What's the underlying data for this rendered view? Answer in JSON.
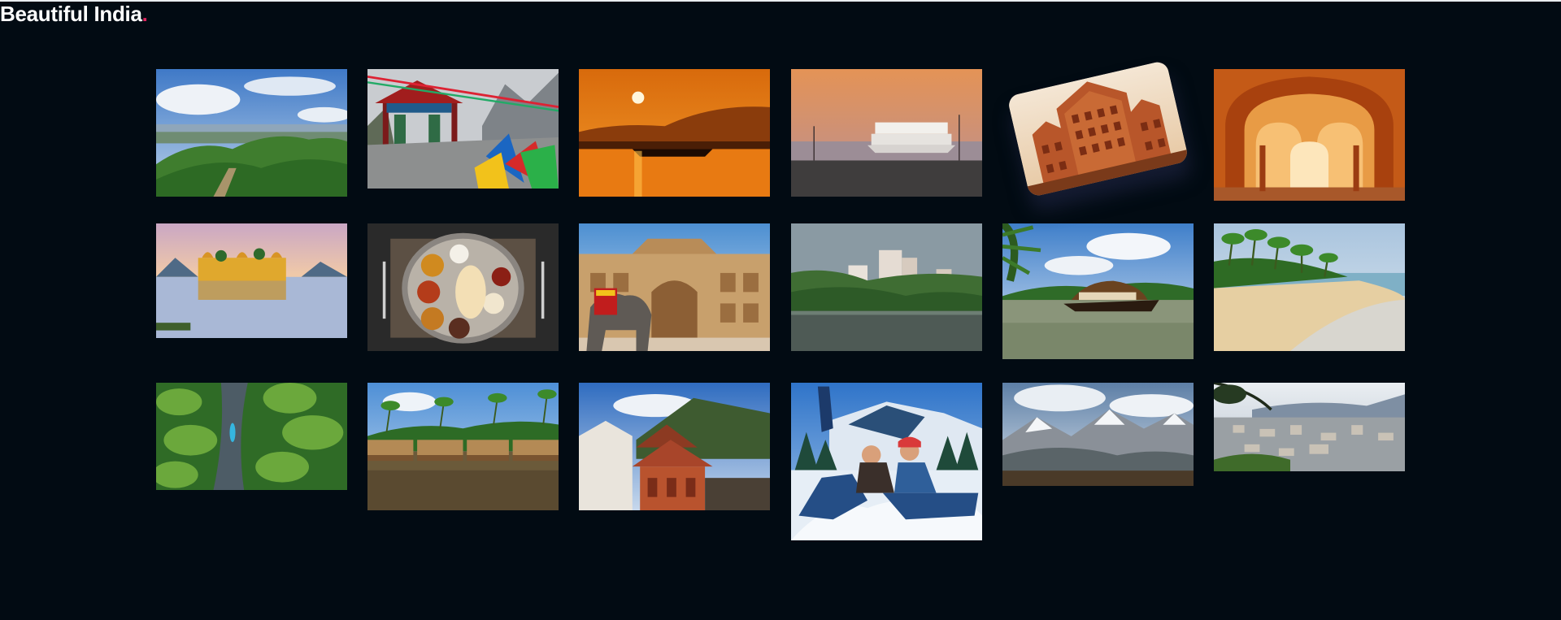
{
  "header": {
    "title": "Beautiful India",
    "title_accent": ".",
    "accent_color": "#e0245e",
    "background": "#020b13"
  },
  "gallery": {
    "items": [
      {
        "icon": "photo-green-hills"
      },
      {
        "icon": "photo-monastery-gate"
      },
      {
        "icon": "photo-sunset-boat"
      },
      {
        "icon": "photo-river-cruise"
      },
      {
        "icon": "photo-hawa-mahal"
      },
      {
        "icon": "photo-palace-arches"
      },
      {
        "icon": "photo-jal-mahal"
      },
      {
        "icon": "photo-thali-meal"
      },
      {
        "icon": "photo-amber-fort-elephant"
      },
      {
        "icon": "photo-city-backwater"
      },
      {
        "icon": "photo-kerala-houseboat"
      },
      {
        "icon": "photo-palm-beach"
      },
      {
        "icon": "photo-canoe-aerial"
      },
      {
        "icon": "photo-houseboats-row"
      },
      {
        "icon": "photo-wooden-temple"
      },
      {
        "icon": "photo-snow-couple"
      },
      {
        "icon": "photo-snow-mountains"
      },
      {
        "icon": "photo-hill-city-view"
      }
    ]
  }
}
